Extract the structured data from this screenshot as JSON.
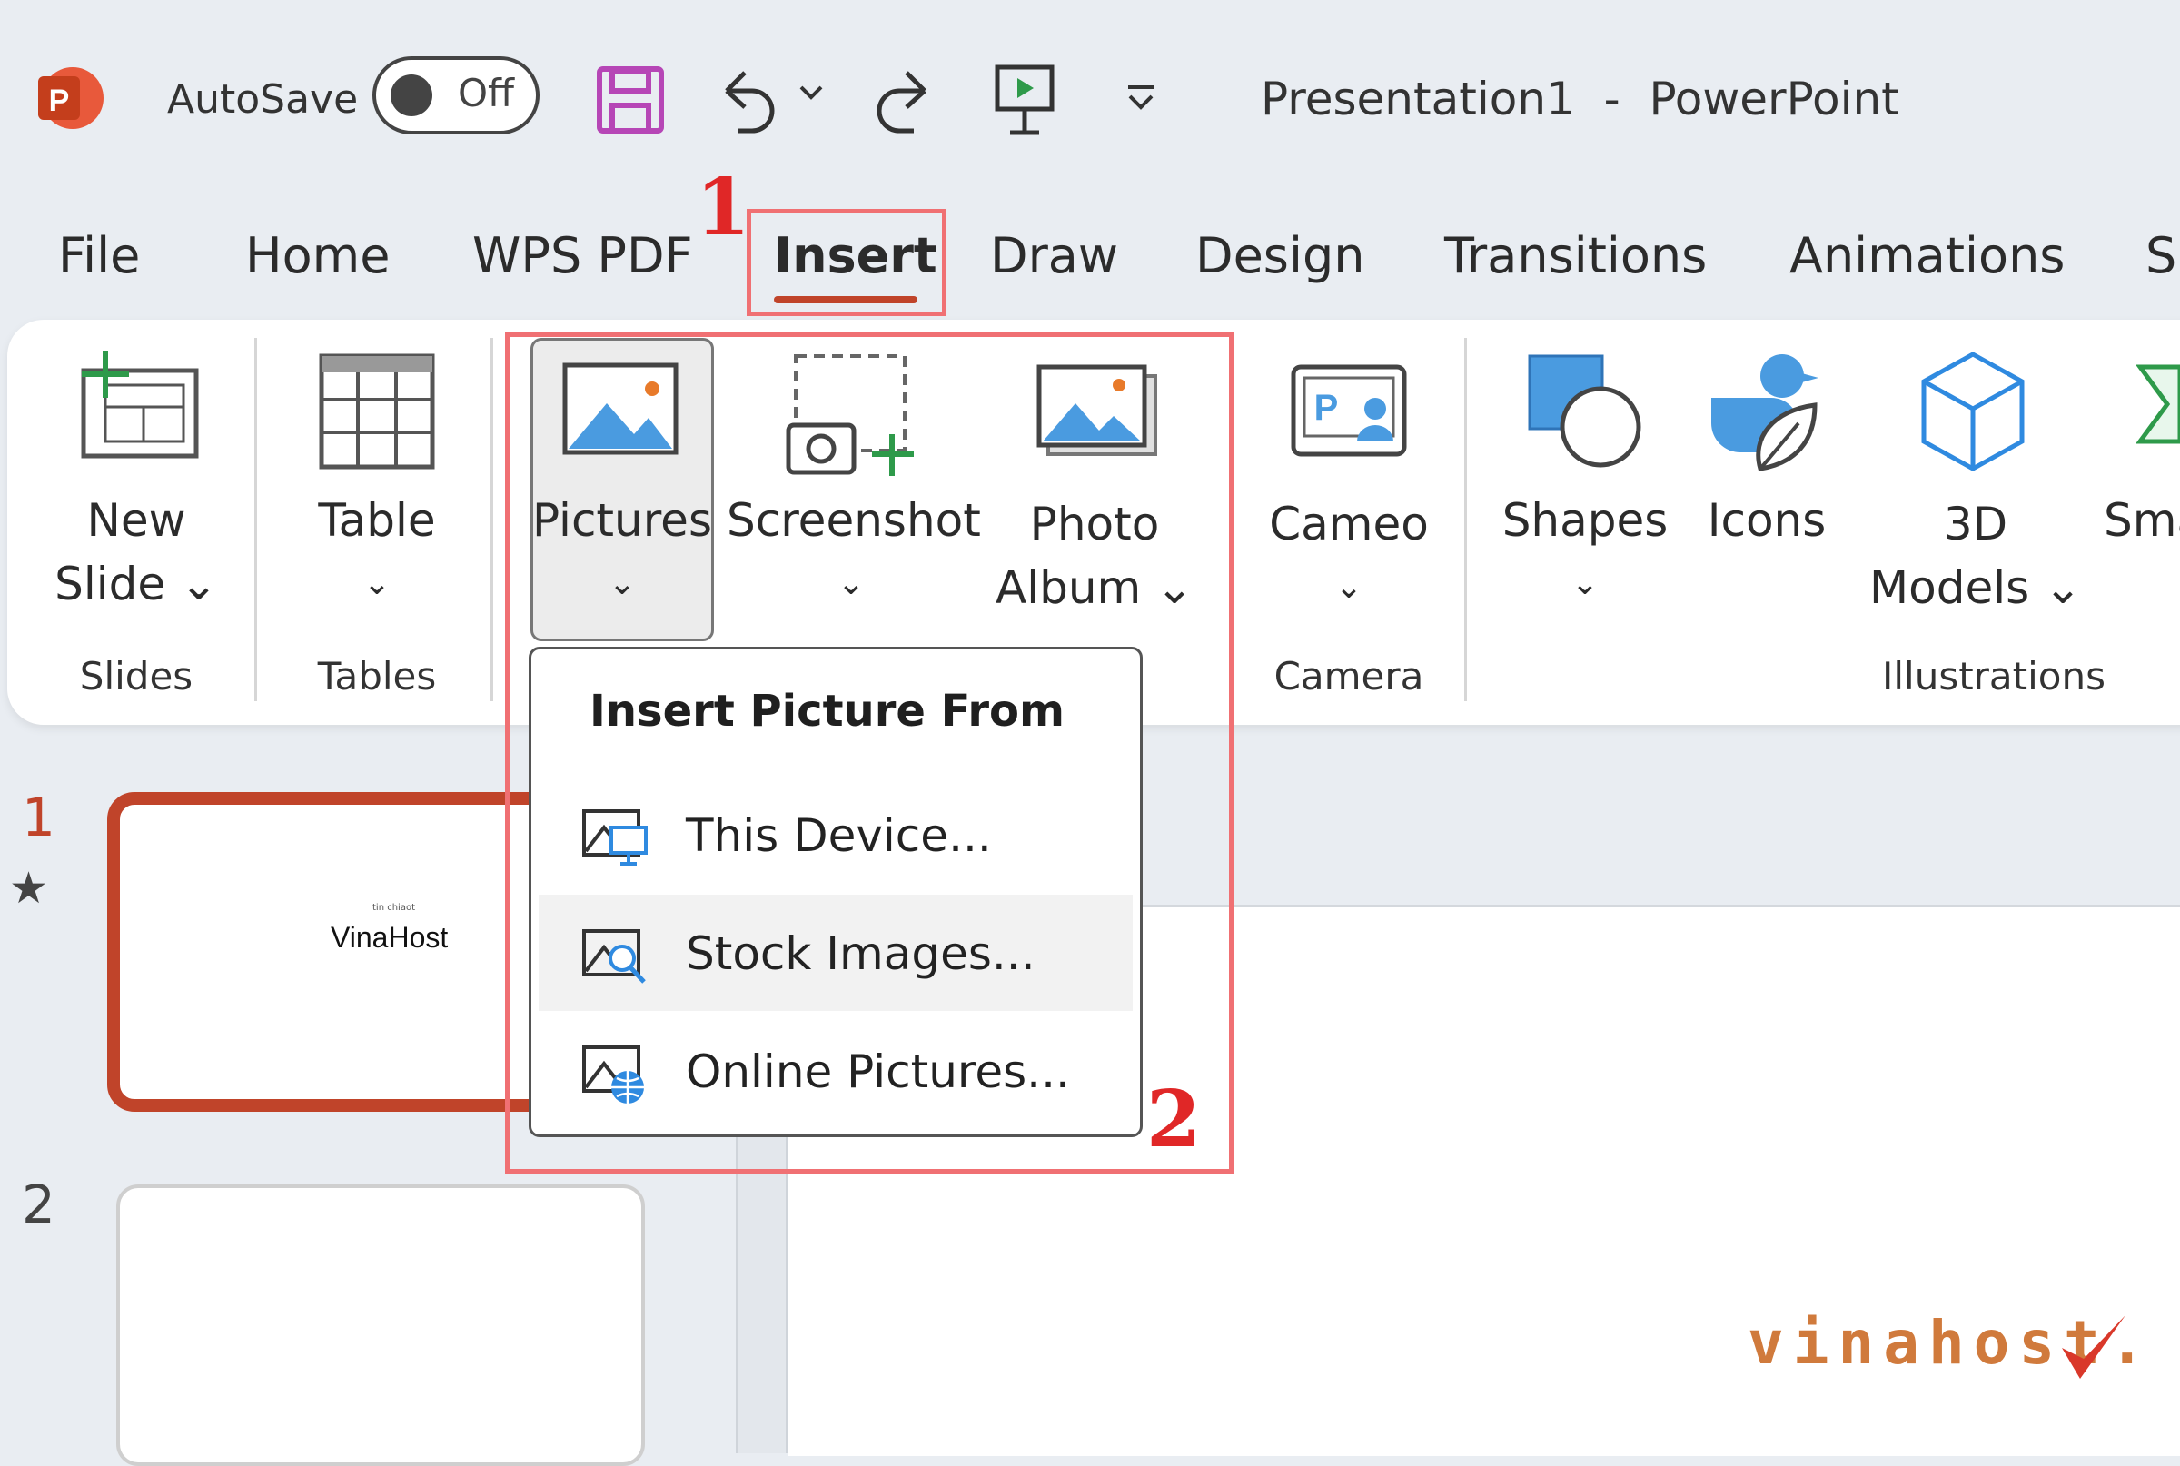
{
  "titlebar": {
    "app_icon": "powerpoint-logo",
    "autosave_label": "AutoSave",
    "autosave_state": "Off",
    "title": "Presentation1  -  PowerPoint"
  },
  "tabs": [
    "File",
    "Home",
    "WPS PDF",
    "Insert",
    "Draw",
    "Design",
    "Transitions",
    "Animations",
    "Sl"
  ],
  "ribbon": {
    "new_slide": [
      "New",
      "Slide ⌄"
    ],
    "table": "Table",
    "pictures": "Pictures",
    "screenshot": "Screenshot",
    "photo_album": [
      "Photo",
      "Album ⌄"
    ],
    "cameo": "Cameo",
    "shapes": "Shapes",
    "icons": "Icons",
    "models": [
      "3D",
      "Models ⌄"
    ],
    "smartart": "Sma",
    "chevron": "⌄",
    "groups": {
      "slides": "Slides",
      "tables": "Tables",
      "camera": "Camera",
      "illustrations": "Illustrations"
    }
  },
  "dropdown": {
    "title": "Insert Picture From",
    "items": [
      {
        "label": "This Device...",
        "icon": "device-picture-icon"
      },
      {
        "label": "Stock Images...",
        "icon": "stock-images-icon"
      },
      {
        "label": "Online Pictures...",
        "icon": "online-pictures-icon"
      }
    ]
  },
  "slides": {
    "slide1_number": "1",
    "slide1_subtitle": "tin chiaot",
    "slide1_title": "VinaHost",
    "slide2_number": "2"
  },
  "annotations": {
    "step1": "1",
    "step2": "2"
  },
  "watermark": "vinahost.",
  "colors": {
    "accent": "#c0442a",
    "annotation": "#f07073",
    "brand": "#b7472a"
  }
}
